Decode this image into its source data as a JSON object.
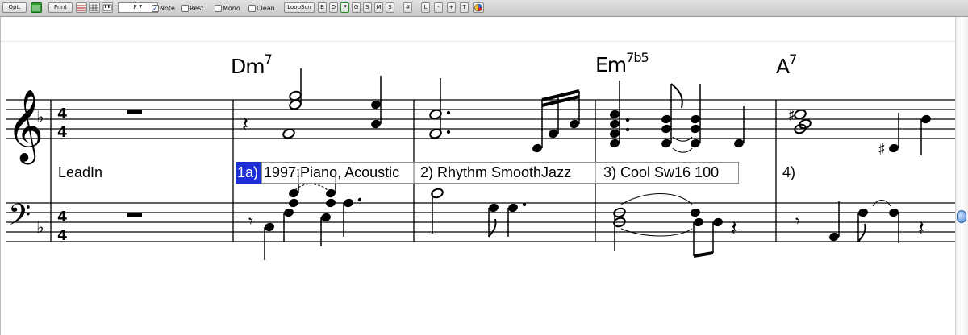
{
  "toolbar": {
    "opt_label": "Opt.",
    "print_label": "Print",
    "field_value": "F 7",
    "note_label": "Note",
    "note_checked": true,
    "rest_label": "Rest",
    "mono_label": "Mono",
    "clean_label": "Clean",
    "loopscn_label": "LoopScn",
    "track_buttons": [
      "B",
      "D",
      "P",
      "G",
      "S",
      "M",
      "S"
    ],
    "sharp_label": "#",
    "letter_buttons": [
      "L",
      "-",
      "+",
      "T"
    ]
  },
  "chords": [
    {
      "root": "Dm",
      "ext": "7"
    },
    {
      "root": "Em",
      "ext": "7b5"
    },
    {
      "root": "A",
      "ext": "7"
    }
  ],
  "time_signature": {
    "top": "4",
    "bottom": "4"
  },
  "lyrics": {
    "leadin": "LeadIn",
    "cursor": "1a)",
    "bar1": "1997:Piano, Acoustic",
    "bar2": "2) Rhythm SmoothJazz",
    "bar3": "3) Cool Sw16 100",
    "bar4": "4)"
  },
  "icons": {
    "staff_icon": "green-staff-icon",
    "lines_icon": "red-lines-icon",
    "grid_icon": "grid-icon",
    "piano_icon": "piano-icon",
    "color_icon": "color-wheel-icon"
  }
}
